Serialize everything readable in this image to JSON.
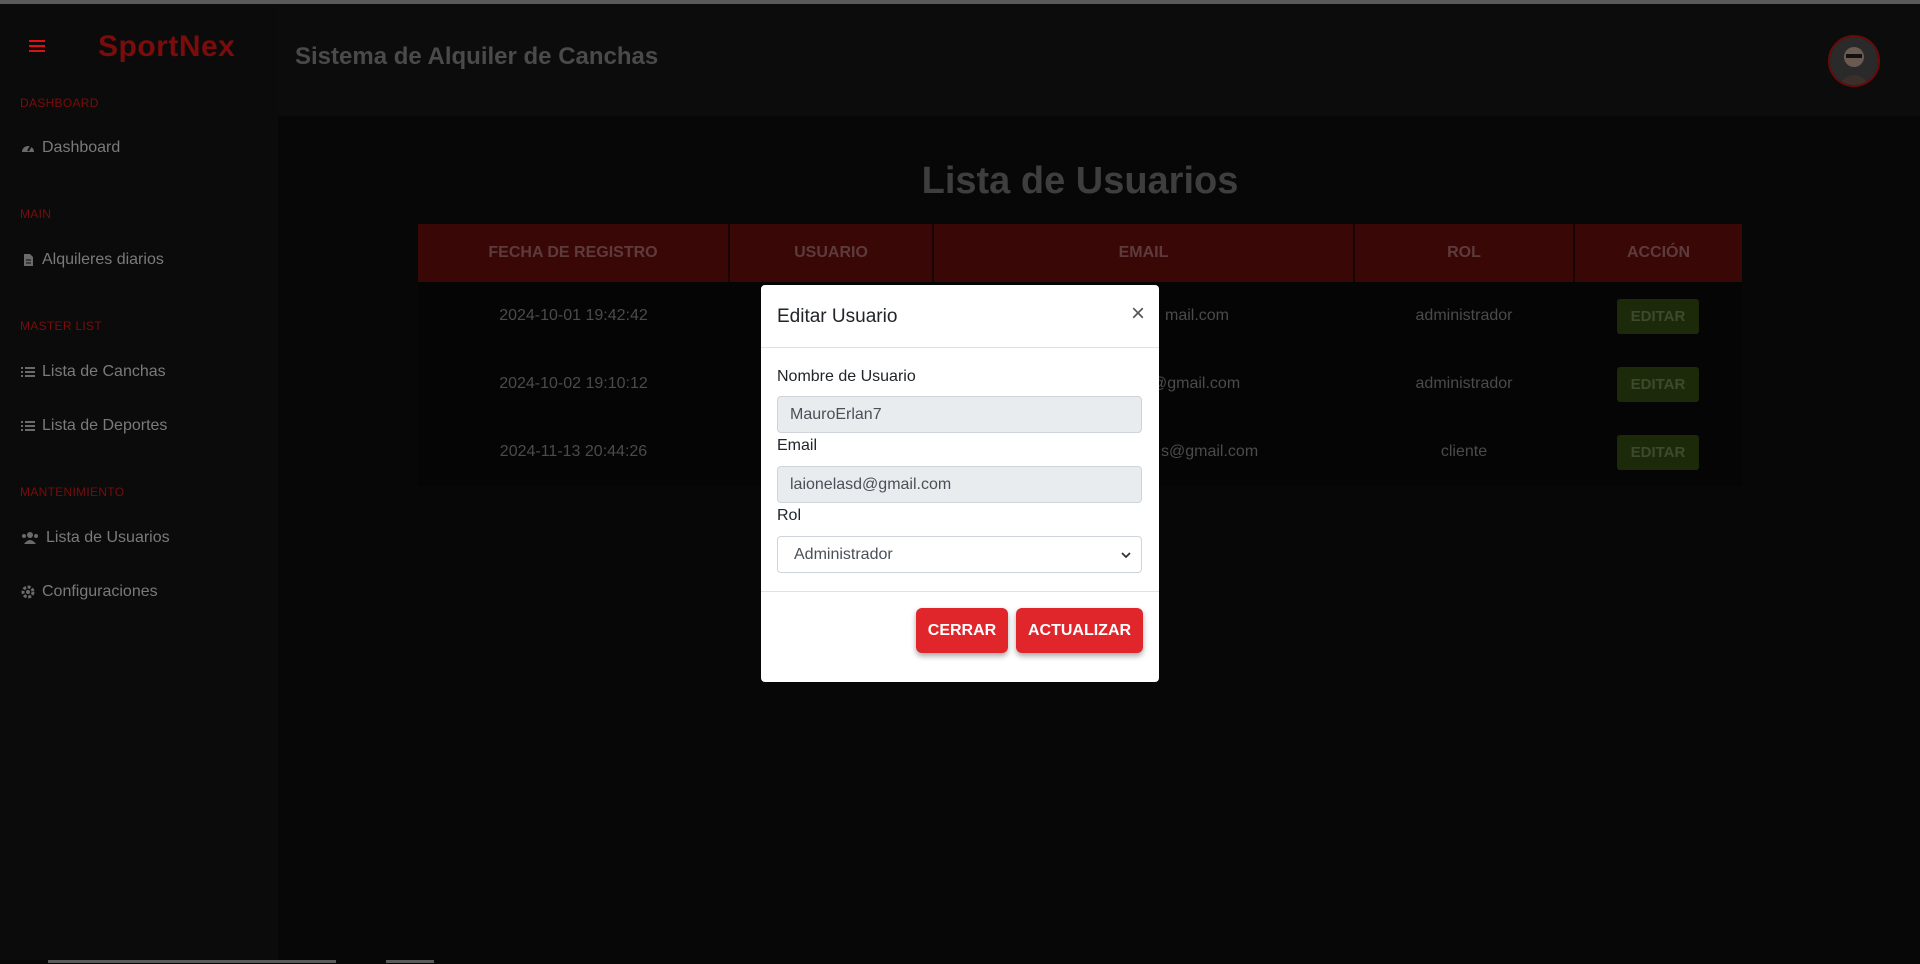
{
  "brand": "SportNex",
  "header": {
    "title": "Sistema de Alquiler de Canchas"
  },
  "sidebar": {
    "sections": [
      {
        "title": "DASHBOARD",
        "items": [
          {
            "label": "Dashboard",
            "icon": "tachometer-icon"
          }
        ]
      },
      {
        "title": "MAIN",
        "items": [
          {
            "label": "Alquileres diarios",
            "icon": "file-icon"
          }
        ]
      },
      {
        "title": "MASTER LIST",
        "items": [
          {
            "label": "Lista de Canchas",
            "icon": "list-icon"
          },
          {
            "label": "Lista de Deportes",
            "icon": "list-icon"
          }
        ]
      },
      {
        "title": "MANTENIMIENTO",
        "items": [
          {
            "label": "Lista de Usuarios",
            "icon": "users-icon"
          },
          {
            "label": "Configuraciones",
            "icon": "gear-icon"
          }
        ]
      }
    ]
  },
  "main": {
    "title": "Lista de Usuarios",
    "columns": [
      "FECHA DE REGISTRO",
      "USUARIO",
      "EMAIL",
      "ROL",
      "ACCIÓN"
    ],
    "rows": [
      {
        "fecha": "2024-10-01 19:42:42",
        "usuario": "",
        "email": "mail.com",
        "rol": "administrador",
        "accion": "EDITAR"
      },
      {
        "fecha": "2024-10-02 19:10:12",
        "usuario": "",
        "email": "@gmail.com",
        "rol": "administrador",
        "accion": "EDITAR"
      },
      {
        "fecha": "2024-11-13 20:44:26",
        "usuario": "",
        "email": "s@gmail.com",
        "rol": "cliente",
        "accion": "EDITAR"
      }
    ]
  },
  "modal": {
    "title": "Editar Usuario",
    "close_symbol": "×",
    "username_label": "Nombre de Usuario",
    "username_value": "MauroErlan7",
    "email_label": "Email",
    "email_value": "laionelasd@gmail.com",
    "role_label": "Rol",
    "role_value": "Administrador",
    "close_button": "CERRAR",
    "update_button": "ACTUALIZAR"
  },
  "colors": {
    "accent": "#e0252b",
    "brand": "#7a0c0c",
    "table_header": "#3a0707",
    "edit_button": "#1c2a0a"
  }
}
